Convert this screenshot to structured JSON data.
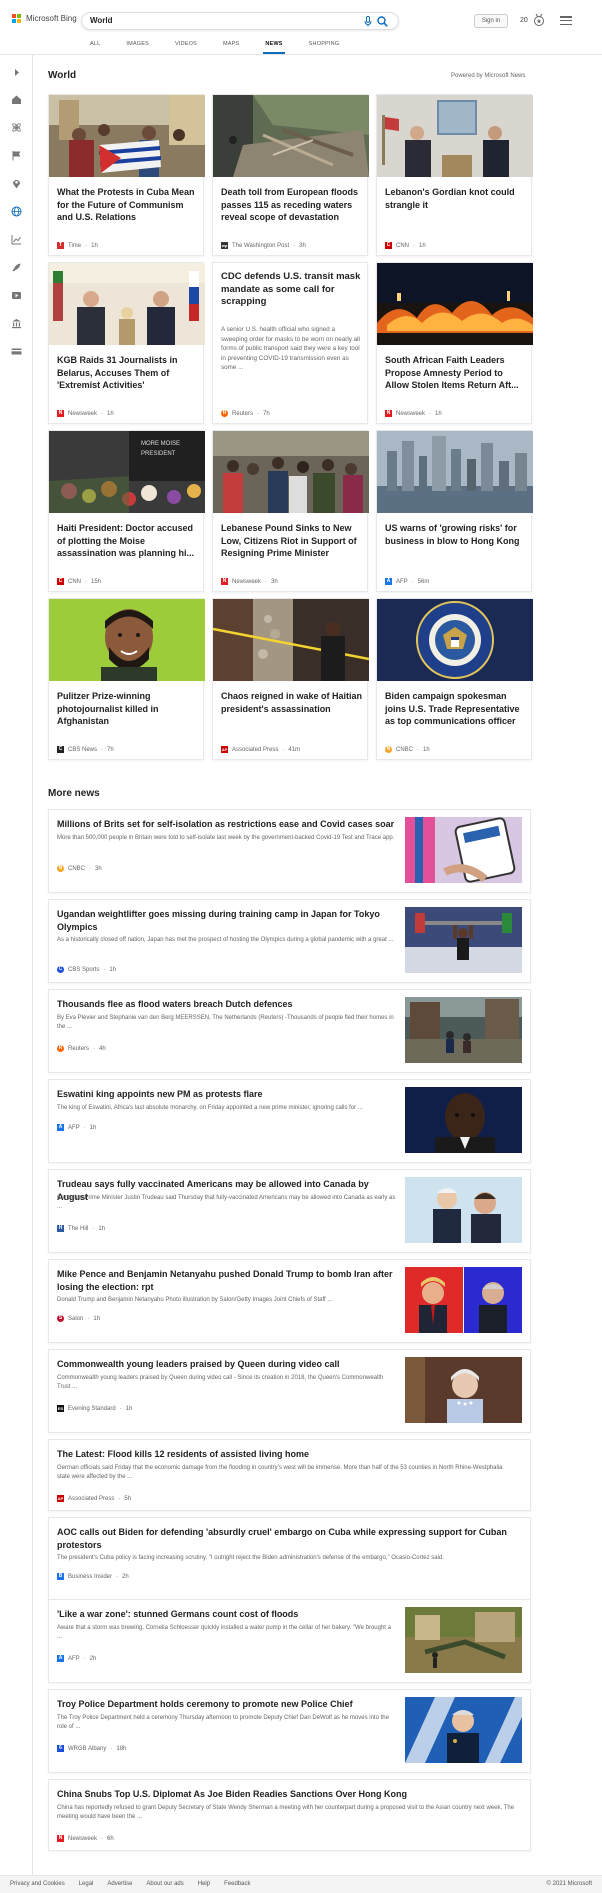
{
  "header": {
    "brand": "Microsoft Bing",
    "search_value": "World",
    "signin_label": "Sign in",
    "rewards_count": "20",
    "tabs": [
      {
        "label": "ALL"
      },
      {
        "label": "IMAGES"
      },
      {
        "label": "VIDEOS"
      },
      {
        "label": "MAPS"
      },
      {
        "label": "NEWS"
      },
      {
        "label": "SHOPPING"
      }
    ],
    "active_tab": "NEWS"
  },
  "colors": {
    "accent": "#0f6cbd",
    "ms_red": "#f25022",
    "ms_green": "#7fba00",
    "ms_blue": "#00a4ef",
    "ms_yellow": "#ffb900"
  },
  "sidebar": {
    "icons": [
      "expand-icon",
      "home-icon",
      "science-icon",
      "flag-icon",
      "location-icon",
      "globe-icon",
      "chart-icon",
      "rocket-icon",
      "film-icon",
      "bank-icon",
      "money-icon"
    ]
  },
  "section": {
    "title": "World",
    "powered": "Powered by Microsoft News"
  },
  "cards": [
    {
      "title": "What the Protests in Cuba Mean for the Future of Communism and U.S. Relations",
      "source": "Time",
      "time": "1h",
      "logo_color": "#d32f2f",
      "logo_text": "T"
    },
    {
      "title": "Death toll from European floods passes 115 as receding waters reveal scope of devastation",
      "source": "The Washington Post",
      "time": "3h",
      "logo_color": "#333333",
      "logo_text": "wp"
    },
    {
      "title": "Lebanon's Gordian knot could strangle it",
      "source": "CNN",
      "time": "1h",
      "logo_color": "#cc0000",
      "logo_text": "C"
    },
    {
      "title": "KGB Raids 31 Journalists in Belarus, Accuses Them of 'Extremist Activities'",
      "source": "Newsweek",
      "time": "1h",
      "logo_color": "#e31b23",
      "logo_text": "N"
    },
    {
      "title": "CDC defends U.S. transit mask mandate as some call for scrapping",
      "snippet": "A senior U.S. health official who signed a sweeping order for masks to be worn on nearly all forms of public transport said they were a key tool in preventing COVID-19 transmission even as some ...",
      "source": "Reuters",
      "time": "7h",
      "logo_color": "#fa6400",
      "logo_text": "R"
    },
    {
      "title": "South African Faith Leaders Propose Amnesty Period to Allow Stolen Items Return Aft...",
      "source": "Newsweek",
      "time": "1h",
      "logo_color": "#e31b23",
      "logo_text": "N"
    },
    {
      "title": "Haiti President: Doctor accused of plotting the Moise assassination was planning hi...",
      "source": "CNN",
      "time": "15h",
      "logo_color": "#cc0000",
      "logo_text": "C"
    },
    {
      "title": "Lebanese Pound Sinks to New Low, Citizens Riot in Support of Resigning Prime Minister",
      "source": "Newsweek",
      "time": "3h",
      "logo_color": "#e31b23",
      "logo_text": "N"
    },
    {
      "title": "US warns of 'growing risks' for business in blow to Hong Kong",
      "source": "AFP",
      "time": "56m",
      "logo_color": "#1a73e8",
      "logo_text": "A"
    },
    {
      "title": "Pulitzer Prize-winning photojournalist killed in Afghanistan",
      "source": "CBS News",
      "time": "7h",
      "logo_color": "#222222",
      "logo_text": "C"
    },
    {
      "title": "Chaos reigned in wake of Haitian president's assassination",
      "source": "Associated Press",
      "time": "41m",
      "logo_color": "#cc0000",
      "logo_text": "AP"
    },
    {
      "title": "Biden campaign spokesman joins U.S. Trade Representative as top communications officer",
      "source": "CNBC",
      "time": "1h",
      "logo_color": "#f5a623",
      "logo_text": "N"
    }
  ],
  "more_news": {
    "title": "More news",
    "items": [
      {
        "title": "Millions of Brits set for self-isolation as restrictions ease and Covid cases soar",
        "snippet": "More than 500,000 people in Britain were told to self-isolate last week by the government-backed Covid-19 Test and Trace app.",
        "source": "CNBC",
        "time": "3h",
        "logo_color": "#f5a623",
        "logo_text": "N"
      },
      {
        "title": "Ugandan weightlifter goes missing during training camp in Japan for Tokyo Olympics",
        "snippet": "As a historically closed off nation, Japan has met the prospect of hosting the Olympics during a global pandemic with a great ...",
        "source": "CBS Sports",
        "time": "1h",
        "logo_color": "#1d4ed8",
        "logo_text": "C"
      },
      {
        "title": "Thousands flee as flood waters breach Dutch defences",
        "snippet": "By Eva Plevier and Stephanie van den Berg MEERSSEN, The Netherlands (Reuters) -Thousands of people fled their homes in the ...",
        "source": "Reuters",
        "time": "4h",
        "logo_color": "#fa6400",
        "logo_text": "R"
      },
      {
        "title": "Eswatini king appoints new PM as protests flare",
        "snippet": "The king of Eswatini, Africa's last absolute monarchy, on Friday appointed a new prime minister, ignoring calls for ...",
        "source": "AFP",
        "time": "1h",
        "logo_color": "#1a73e8",
        "logo_text": "A"
      },
      {
        "title": "Trudeau says fully vaccinated Americans may be allowed into Canada by August",
        "snippet": "Canadian Prime Minister Justin Trudeau said Thursday that fully-vaccinated Americans may be allowed into Canada as early as ...",
        "source": "The Hill",
        "time": "1h",
        "logo_color": "#2c5aa0",
        "logo_text": "H"
      },
      {
        "title": "Mike Pence and Benjamin Netanyahu pushed Donald Trump to bomb Iran after losing the election: rpt",
        "snippet": "Donald Trump and Benjamin Netanyahu Photo illustration by Salon/Getty Images Joint Chiefs of Staff ...",
        "source": "Salon",
        "time": "1h",
        "logo_color": "#c0102a",
        "logo_text": "S"
      },
      {
        "title": "Commonwealth young leaders praised by Queen during video call",
        "snippet": "Commonwealth young leaders praised by Queen during video call - Since its creation in 2018, the Queen's Commonwealth Trust ...",
        "source": "Evening Standard",
        "time": "1h",
        "logo_color": "#111111",
        "logo_text": "ES"
      },
      {
        "title": "The Latest: Flood kills 12 residents of assisted living home",
        "snippet": "German officials said Friday that the economic damage from the flooding in country's west will be immense. More than half of the 53 counties in North Rhine-Westphalia state were affected by the ...",
        "source": "Associated Press",
        "time": "5h",
        "logo_color": "#cc0000",
        "logo_text": "AP"
      },
      {
        "title": "AOC calls out Biden for defending 'absurdly cruel' embargo on Cuba while expressing support for Cuban protestors",
        "snippet": "The president's Cuba policy is facing increasing scrutiny. \"I outright reject the Biden administration's defense of the embargo,\" Ocasio-Cortez said.",
        "source": "Business Insider",
        "time": "2h",
        "logo_color": "#1a73e8",
        "logo_text": "B"
      },
      {
        "title": "'Like a war zone': stunned Germans count cost of floods",
        "snippet": "Aware that a storm was brewing, Cornelia Schloesser quickly installed a water pump in the cellar of her bakery. \"We brought a ...",
        "source": "AFP",
        "time": "2h",
        "logo_color": "#1a73e8",
        "logo_text": "A"
      },
      {
        "title": "Troy Police Department holds ceremony to promote new Police Chief",
        "snippet": "The Troy Police Department held a ceremony Thursday afternoon to promote Deputy Chief Dan DeWolf as he moves into the role of ...",
        "source": "WRGB Albany",
        "time": "18h",
        "logo_color": "#1d4ed8",
        "logo_text": "6"
      },
      {
        "title": "China Snubs Top U.S. Diplomat As Joe Biden Readies Sanctions Over Hong Kong",
        "snippet": "China has reportedly refused to grant Deputy Secretary of State Wendy Sherman a meeting with her counterpart during a proposed visit to the Asian country next week. The meeting would have been the ...",
        "source": "Newsweek",
        "time": "6h",
        "logo_color": "#e31b23",
        "logo_text": "N"
      }
    ]
  },
  "footer": {
    "links": [
      "Privacy and Cookies",
      "Legal",
      "Advertise",
      "About our ads",
      "Help",
      "Feedback"
    ],
    "copyright": "© 2021 Microsoft"
  }
}
